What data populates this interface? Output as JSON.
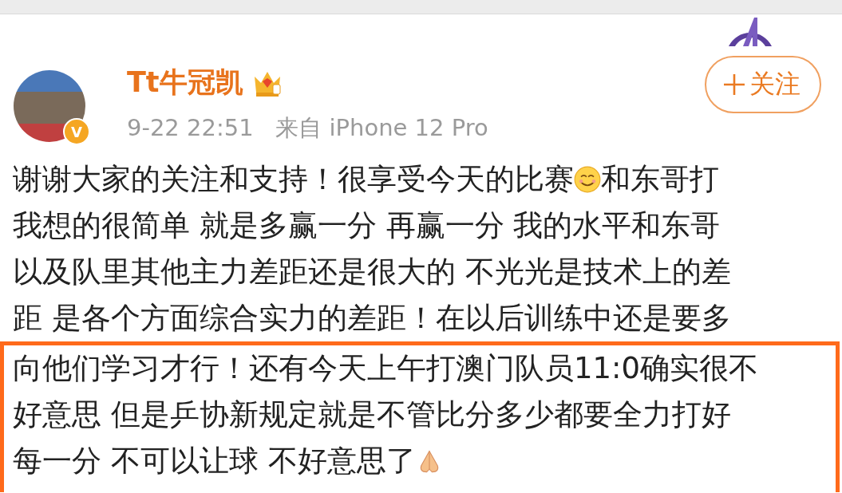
{
  "author": {
    "name": "Tt牛冠凯",
    "verified_badge": "V",
    "meta": "9-22 22:51   来自 iPhone 12 Pro"
  },
  "follow_button": {
    "label": "关注"
  },
  "post": {
    "lines": [
      {
        "kind": "emoji-mid",
        "text": "谢谢大家的关注和支持！很享受今天的比赛",
        "text_after": "和东哥打"
      },
      {
        "kind": "plain",
        "text": "我想的很简单 就是多赢一分 再赢一分 我的水平和东哥"
      },
      {
        "kind": "plain",
        "text": "以及队里其他主力差距还是很大的  不光光是技术上的差"
      },
      {
        "kind": "plain",
        "text": "距 是各个方面综合实力的差距！在以后训练中还是要多"
      }
    ],
    "highlighted_lines": [
      {
        "kind": "plain",
        "text": "向他们学习才行！还有今天上午打澳门队员11:0确实很不"
      },
      {
        "kind": "plain",
        "text": "好意思 但是乒协新规定就是不管比分多少都要全力打好"
      },
      {
        "kind": "emoji-end",
        "text": "每一分  不可以让球 不好意思了"
      }
    ]
  }
}
